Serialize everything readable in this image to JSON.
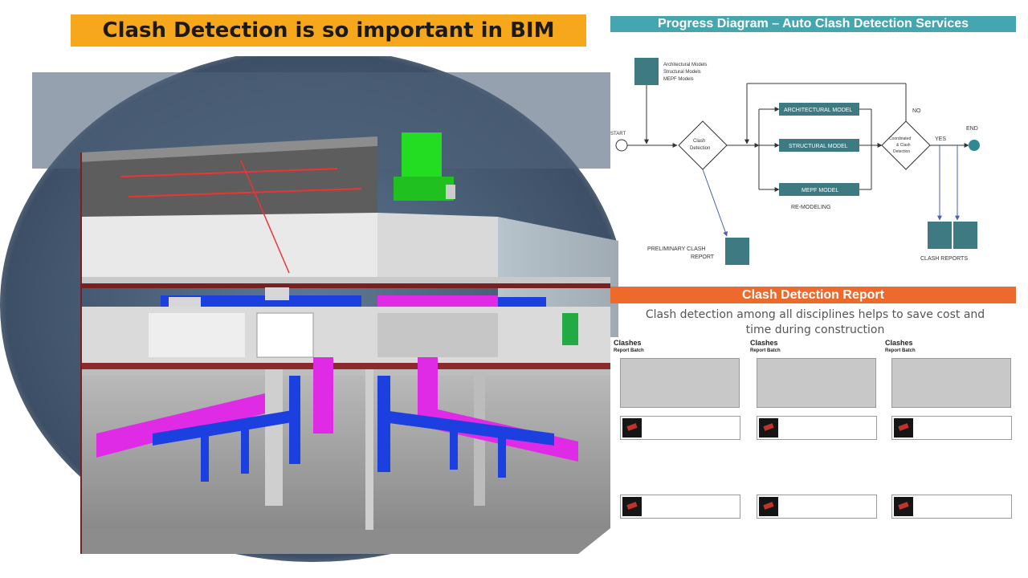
{
  "banner": {
    "title": "Clash Detection is so important in BIM"
  },
  "progress": {
    "title": "Progress Diagram – Auto Clash Detection Services",
    "models_label_1": "Architectural Models",
    "models_label_2": "Structural Models",
    "models_label_3": "MEPF Models",
    "start": "START",
    "clash_1": "Clash",
    "clash_2": "Detection",
    "arch_model": "ARCHITECTURAL MODEL",
    "struct_model": "STRUCTURAL MODEL",
    "mepf_model": "MEPF MODEL",
    "remodeling": "RE-MODELING",
    "decision_1": "Coordinated",
    "decision_2": "& Clash",
    "decision_3": "Detection",
    "no": "NO",
    "yes": "YES",
    "end": "END",
    "prelim_1": "PRELIMINARY CLASH",
    "prelim_2": "REPORT",
    "clash_reports": "CLASH REPORTS"
  },
  "report": {
    "title": "Clash Detection Report",
    "note_1": "Clash detection among all disciplines helps to save cost and",
    "note_2": "time during construction",
    "panels": [
      {
        "title": "Clashes",
        "sub": "Report Batch"
      },
      {
        "title": "Clashes",
        "sub": "Report Batch"
      },
      {
        "title": "Clashes",
        "sub": "Report Batch"
      }
    ]
  },
  "colors": {
    "banner": "#f7a71c",
    "progress_bar": "#46a6b0",
    "report_bar": "#ee6a2c",
    "duct_pink": "#e02be6",
    "duct_blue": "#1c3fe0",
    "tank_green": "#22dd22"
  }
}
